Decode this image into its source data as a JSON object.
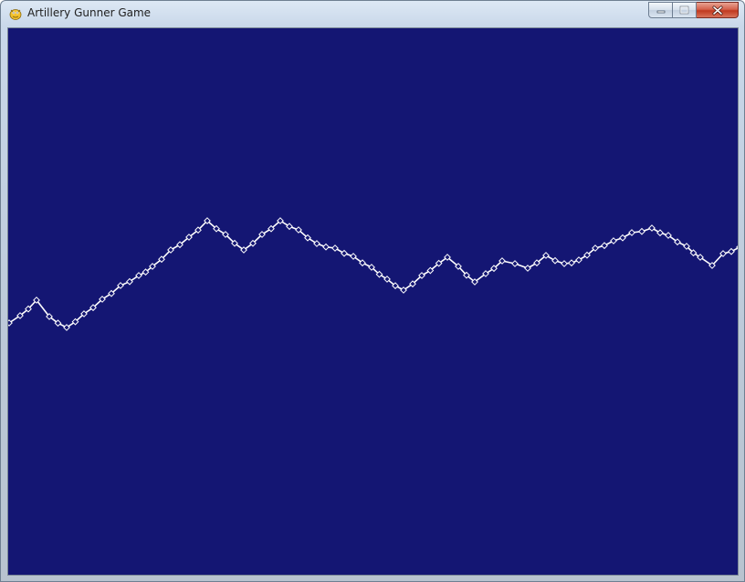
{
  "window": {
    "title": "Artillery Gunner Game",
    "app_icon": "pygame-snake-icon",
    "caption_buttons": [
      "minimize",
      "maximize",
      "close"
    ]
  },
  "game": {
    "background_color": "#141673",
    "terrain_color": "#ffffff",
    "terrain_marker": "diamond-outline"
  }
}
